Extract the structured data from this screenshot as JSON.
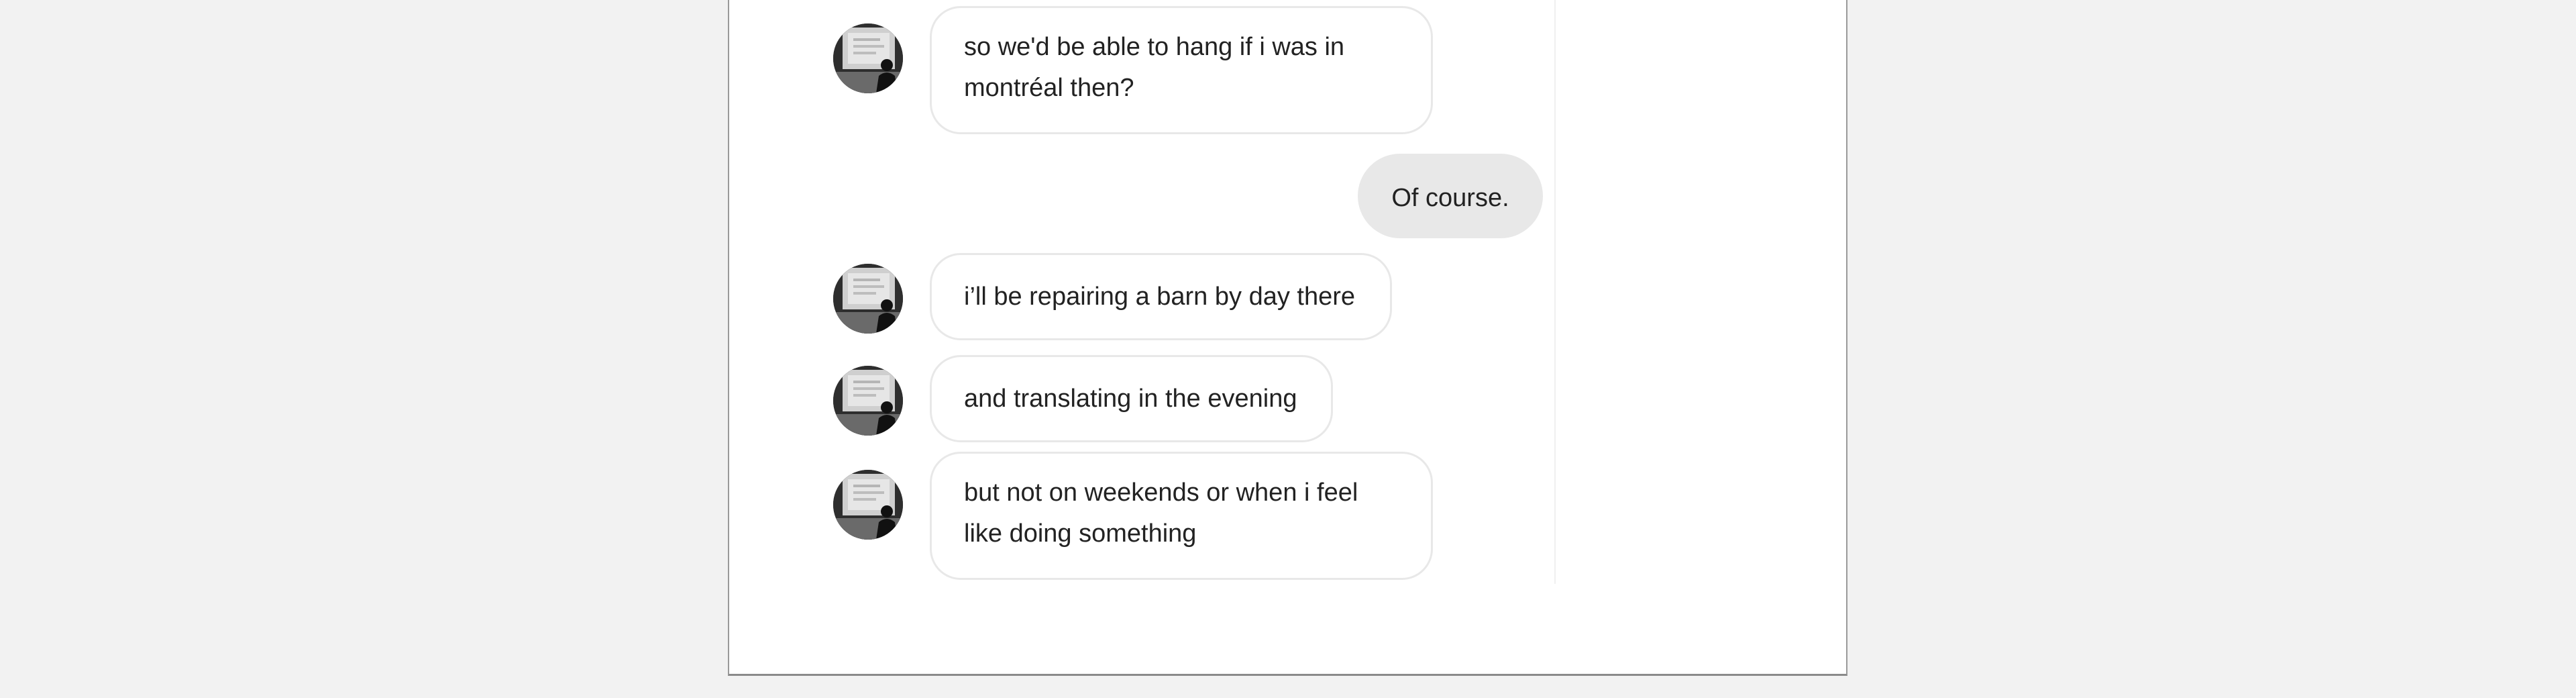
{
  "conversation": {
    "messages": [
      {
        "sender": "them",
        "text": "so we'd be able to hang if i was in montréal then?"
      },
      {
        "sender": "me",
        "text": "Of course."
      },
      {
        "sender": "them",
        "text": "i’ll be repairing a barn by day there"
      },
      {
        "sender": "them",
        "text": "and translating in the evening"
      },
      {
        "sender": "them",
        "text": "but not on weekends or when i feel like doing something"
      }
    ]
  },
  "colors": {
    "outgoing_bubble": "#e8e8e8",
    "incoming_border": "#e8e8e8",
    "background": "#f2f2f2"
  },
  "icons": {
    "avatar": "contact-photo-avatar"
  }
}
